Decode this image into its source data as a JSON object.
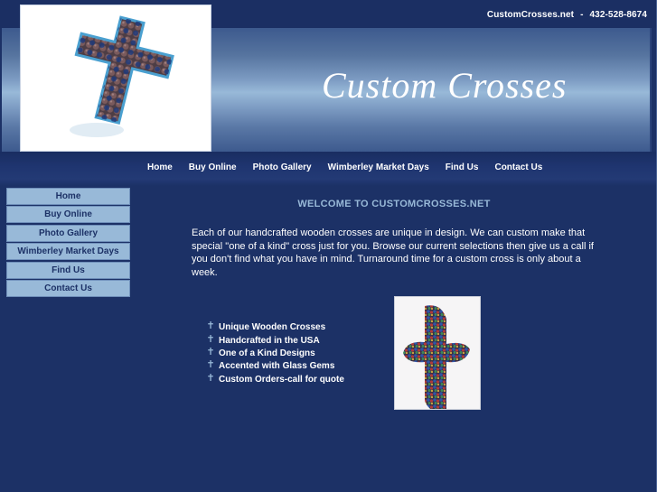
{
  "header": {
    "site_name": "CustomCrosses.net",
    "separator": "-",
    "phone": "432-528-8674",
    "banner_title": "Custom Crosses",
    "logo_alt": "glass-gem-cross-image"
  },
  "top_nav": {
    "items": [
      {
        "label": "Home"
      },
      {
        "label": "Buy Online"
      },
      {
        "label": "Photo Gallery"
      },
      {
        "label": "Wimberley Market Days"
      },
      {
        "label": "Find Us"
      },
      {
        "label": "Contact Us"
      }
    ]
  },
  "side_nav": {
    "items": [
      {
        "label": "Home"
      },
      {
        "label": "Buy Online"
      },
      {
        "label": "Photo Gallery"
      },
      {
        "label": "Wimberley Market Days"
      },
      {
        "label": "Find Us"
      },
      {
        "label": "Contact Us"
      }
    ]
  },
  "main": {
    "heading": "WELCOME TO CUSTOMCROSSES.NET",
    "intro": "Each of our handcrafted wooden crosses are unique in design.  We can custom make that special \"one of a kind\" cross just for you.  Browse our current selections then give us a call if you don't find what you have in mind.  Turnaround time for a custom cross is only about a week.",
    "bullet_icon": "cross-icon",
    "bullet_glyph": "✝",
    "features": [
      "Unique Wooden Crosses",
      "Handcrafted in the USA",
      "One of a Kind Designs",
      "Accented with Glass Gems",
      "Custom Orders-call for quote"
    ],
    "photo_alt": "multicolor-bead-cross-image"
  },
  "colors": {
    "background": "#1c3166",
    "accent_light": "#98b9d8",
    "text": "#ffffff"
  }
}
